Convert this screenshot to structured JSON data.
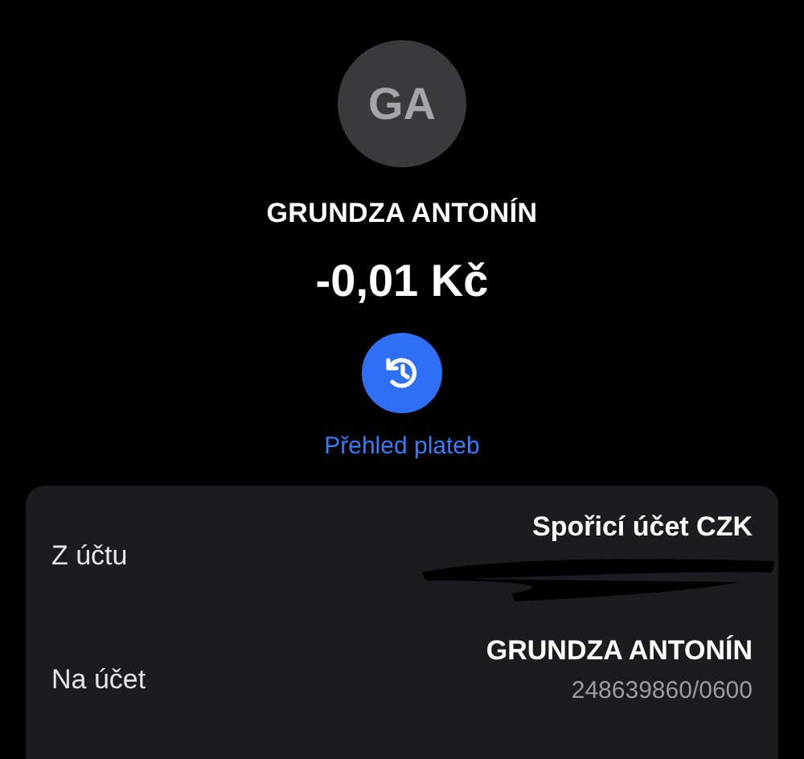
{
  "avatar": {
    "initials": "GA"
  },
  "name": "GRUNDZA ANTONÍN",
  "amount": "-0,01 Kč",
  "history_action": {
    "label": "Přehled plateb"
  },
  "details": [
    {
      "label": "Z účtu",
      "value": "Spořicí účet CZK",
      "detail_hidden": true
    },
    {
      "label": "Na účet",
      "value": "GRUNDZA ANTONÍN",
      "detail": "248639860/0600",
      "detail_hidden": false
    }
  ]
}
